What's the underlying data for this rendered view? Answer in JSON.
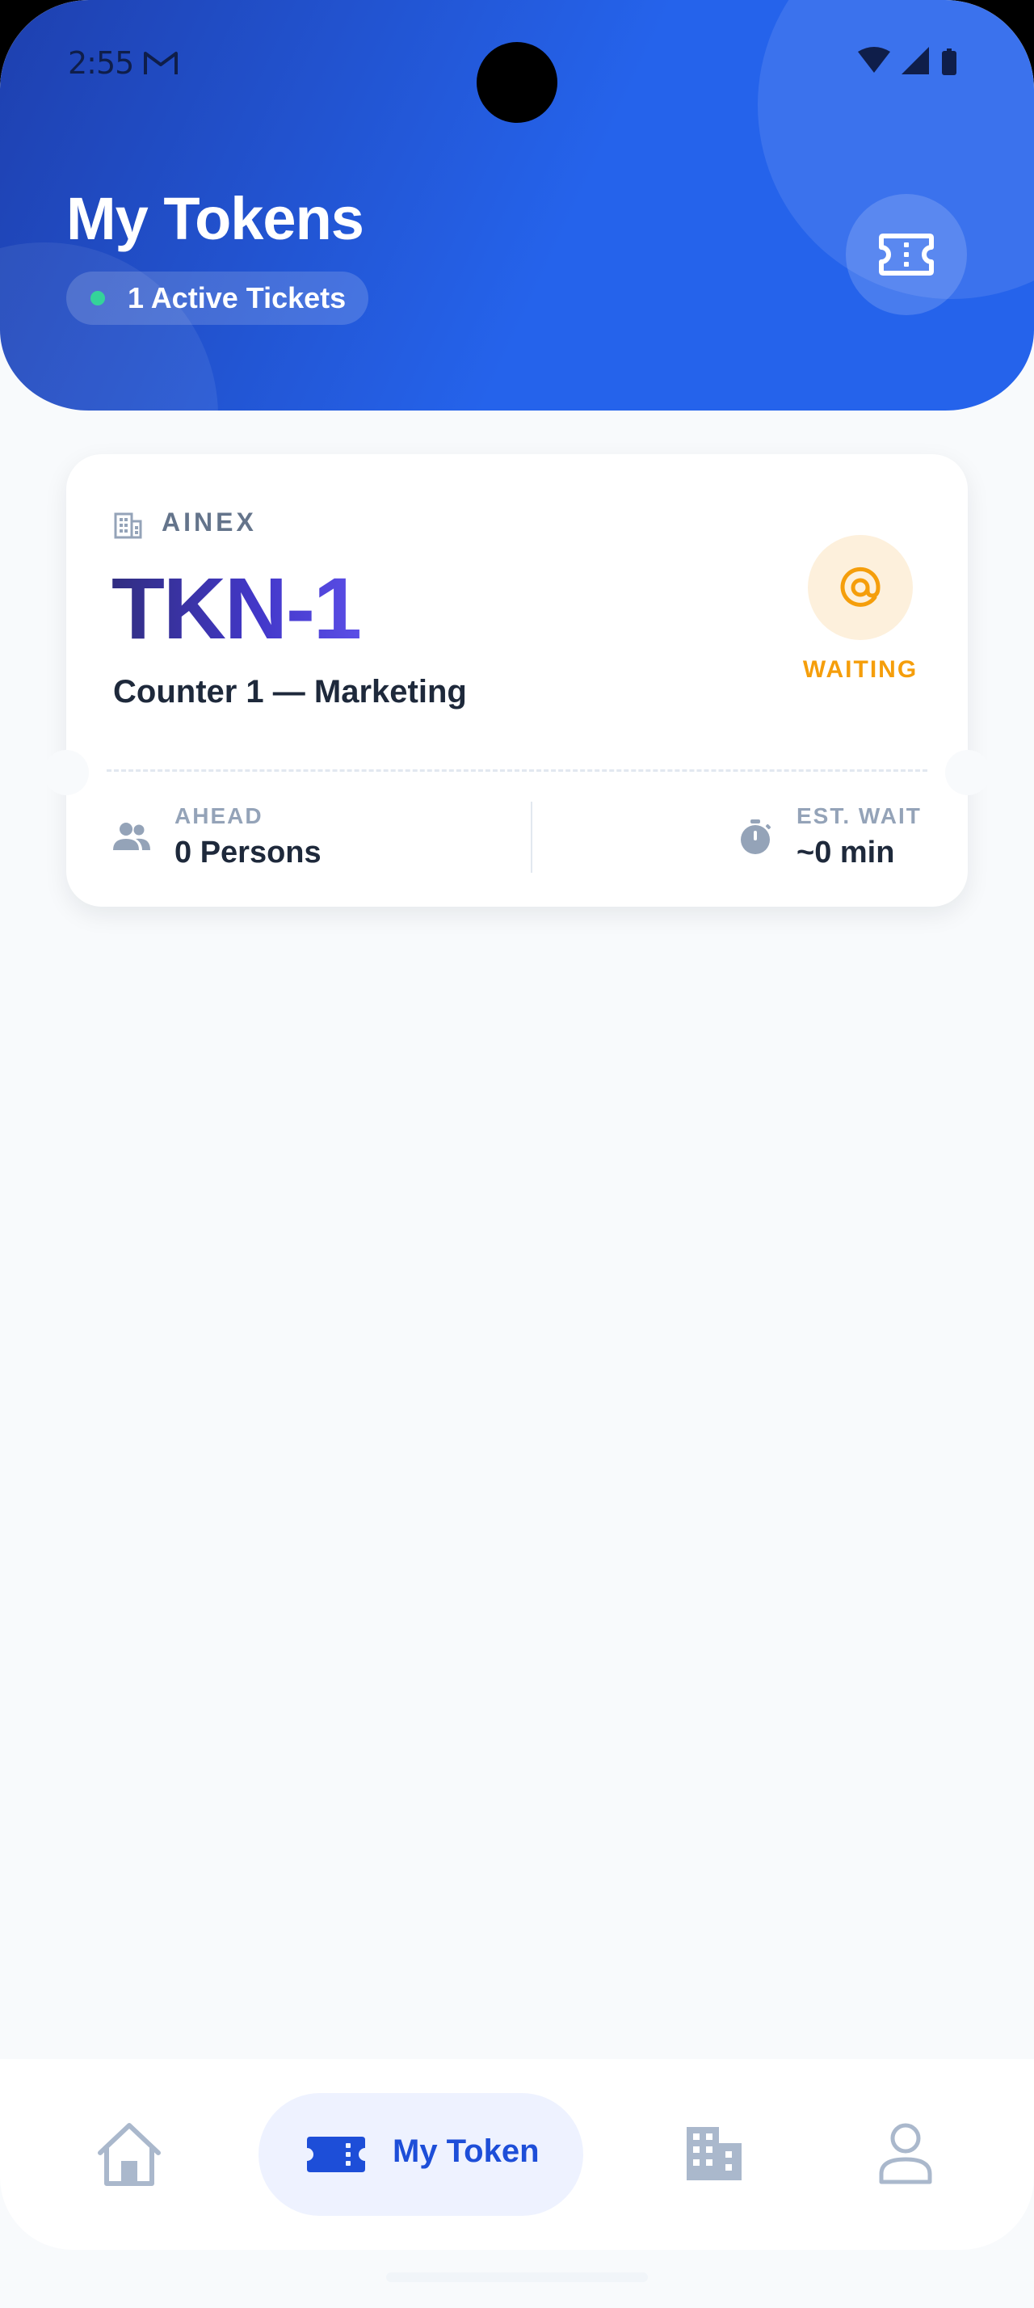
{
  "status_bar": {
    "time": "2:55"
  },
  "header": {
    "title": "My Tokens",
    "active_count": "1 Active Tickets"
  },
  "token_card": {
    "organization": "AINEX",
    "token_number": "TKN-1",
    "counter": "Counter 1 — Marketing",
    "status": "WAITING",
    "ahead": {
      "label": "AHEAD",
      "value": "0 Persons"
    },
    "est_wait": {
      "label": "EST. WAIT",
      "value": "~0 min"
    }
  },
  "nav": {
    "items": [
      {
        "id": "home",
        "icon": "home-icon",
        "label": ""
      },
      {
        "id": "my-token",
        "icon": "ticket-icon",
        "label": "My Token",
        "active": true
      },
      {
        "id": "organizations",
        "icon": "building-icon",
        "label": ""
      },
      {
        "id": "profile",
        "icon": "person-icon",
        "label": ""
      }
    ]
  },
  "colors": {
    "primary": "#2563eb",
    "token_text": "#3730a3",
    "waiting": "#f59e0b",
    "active_dot": "#34d399",
    "nav_inactive": "#aab8cc"
  }
}
